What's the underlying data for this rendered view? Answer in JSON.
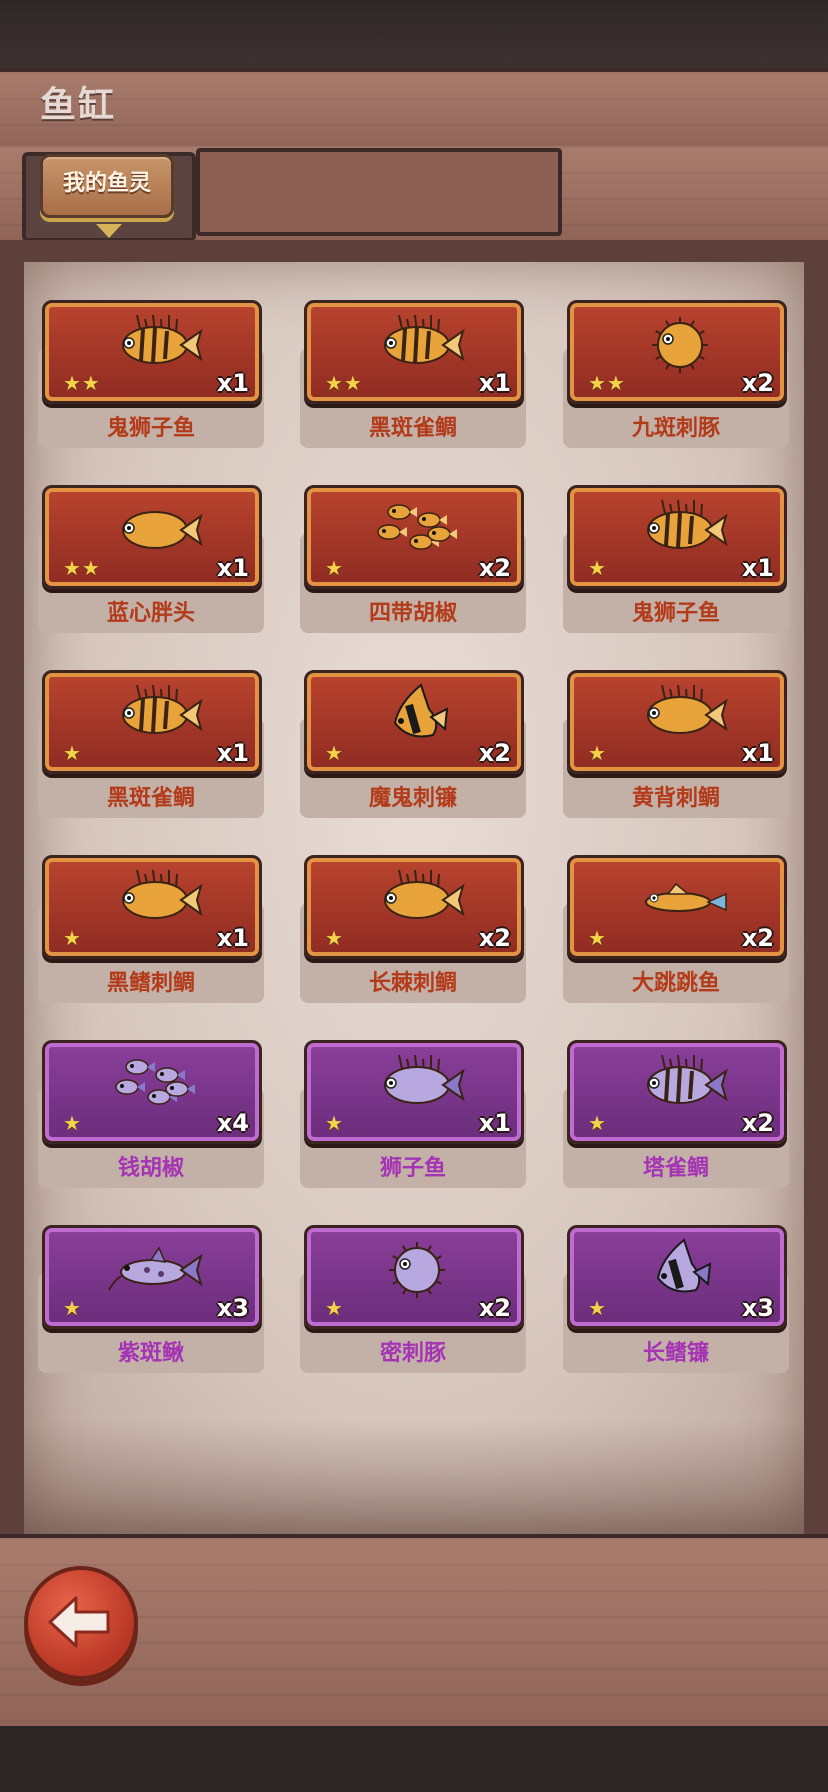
{
  "header": {
    "title": "鱼缸"
  },
  "tabs": [
    {
      "label": "我的鱼灵",
      "active": true
    }
  ],
  "fish": [
    {
      "name": "鬼狮子鱼",
      "stars": "★★",
      "quantity": "x1",
      "rarity": "orange",
      "icon": "striped-lionfish-icon"
    },
    {
      "name": "黑斑雀鲷",
      "stars": "★★",
      "quantity": "x1",
      "rarity": "orange",
      "icon": "lionfish-icon"
    },
    {
      "name": "九斑刺豚",
      "stars": "★★",
      "quantity": "x2",
      "rarity": "orange",
      "icon": "pufferfish-icon"
    },
    {
      "name": "蓝心胖头",
      "stars": "★★",
      "quantity": "x1",
      "rarity": "orange",
      "icon": "round-fish-icon"
    },
    {
      "name": "四带胡椒",
      "stars": "★",
      "quantity": "x2",
      "rarity": "orange",
      "icon": "fish-school-icon"
    },
    {
      "name": "鬼狮子鱼",
      "stars": "★",
      "quantity": "x1",
      "rarity": "orange",
      "icon": "striped-lionfish-icon"
    },
    {
      "name": "黑斑雀鲷",
      "stars": "★",
      "quantity": "x1",
      "rarity": "orange",
      "icon": "lionfish-icon"
    },
    {
      "name": "魔鬼刺镰",
      "stars": "★",
      "quantity": "x2",
      "rarity": "orange",
      "icon": "moorish-idol-icon"
    },
    {
      "name": "黄背刺鲷",
      "stars": "★",
      "quantity": "x1",
      "rarity": "orange",
      "icon": "spiny-fish-icon"
    },
    {
      "name": "黑鳍刺鲷",
      "stars": "★",
      "quantity": "x1",
      "rarity": "orange",
      "icon": "spiny-fish-icon"
    },
    {
      "name": "长棘刺鲷",
      "stars": "★",
      "quantity": "x2",
      "rarity": "orange",
      "icon": "spiny-fish-icon"
    },
    {
      "name": "大跳跳鱼",
      "stars": "★",
      "quantity": "x2",
      "rarity": "orange",
      "icon": "mudskipper-icon"
    },
    {
      "name": "钱胡椒",
      "stars": "★",
      "quantity": "x4",
      "rarity": "purple",
      "icon": "fish-school-icon"
    },
    {
      "name": "狮子鱼",
      "stars": "★",
      "quantity": "x1",
      "rarity": "purple",
      "icon": "spiny-fish-icon"
    },
    {
      "name": "塔雀鲷",
      "stars": "★",
      "quantity": "x2",
      "rarity": "purple",
      "icon": "lionfish-icon"
    },
    {
      "name": "紫斑鳅",
      "stars": "★",
      "quantity": "x3",
      "rarity": "purple",
      "icon": "catfish-icon"
    },
    {
      "name": "密刺豚",
      "stars": "★",
      "quantity": "x2",
      "rarity": "purple",
      "icon": "pufferfish-icon"
    },
    {
      "name": "长鳍镰",
      "stars": "★",
      "quantity": "x3",
      "rarity": "purple",
      "icon": "moorish-idol-icon"
    }
  ],
  "footer": {
    "back_icon": "back-arrow-icon"
  },
  "colors": {
    "orange_card": "#a3382a",
    "purple_card": "#7a3489",
    "star": "#f4d24a",
    "back_button": "#d84a34"
  }
}
